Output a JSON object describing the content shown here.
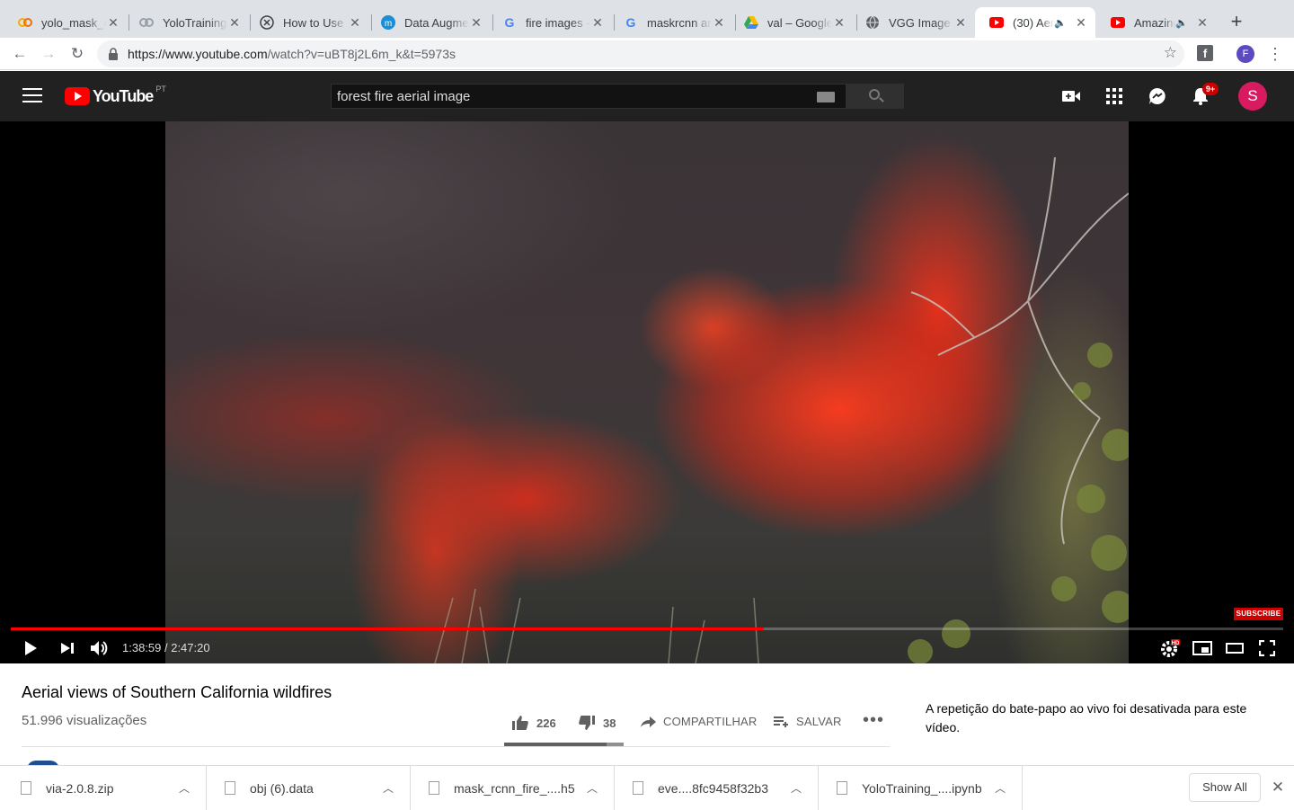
{
  "browser": {
    "tabs": [
      {
        "title": "yolo_mask_c",
        "icon": "colab-icon"
      },
      {
        "title": "YoloTraining",
        "icon": "colab-icon"
      },
      {
        "title": "How to Use",
        "icon": "x-circle-icon"
      },
      {
        "title": "Data Augme",
        "icon": "medium-icon"
      },
      {
        "title": "fire images -",
        "icon": "google-icon"
      },
      {
        "title": "maskrcnn ar",
        "icon": "google-icon"
      },
      {
        "title": "val – Google",
        "icon": "google-drive-icon"
      },
      {
        "title": "VGG Image /",
        "icon": "globe-icon"
      },
      {
        "title": "(30) Aer",
        "icon": "youtube-icon"
      },
      {
        "title": "Amazing",
        "icon": "youtube-icon"
      }
    ],
    "url_host": "https://www.youtube.com",
    "url_path": "/watch?v=uBT8j2L6m_k&t=5973s",
    "profile_initial": "F"
  },
  "youtube": {
    "logo_text": "YouTube",
    "region": "PT",
    "search_query": "forest fire aerial image",
    "notification_count": "9+",
    "avatar_initial": "S"
  },
  "player": {
    "subscribe_label": "SUBSCRIBE",
    "current_time": "1:38:59",
    "duration": "2:47:20",
    "time_display": "1:38:59 / 2:47:20",
    "progress_fraction": 0.592,
    "hd_badge": "HD"
  },
  "video": {
    "title": "Aerial views of Southern California wildfires",
    "views": "51.996 visualizações",
    "likes": "226",
    "dislikes": "38",
    "share_label": "COMPARTILHAR",
    "save_label": "SALVAR",
    "like_fraction": 0.856
  },
  "chat": {
    "replay_disabled_message": "A repetição do bate-papo ao vivo foi desativada para este vídeo."
  },
  "downloads": {
    "items": [
      {
        "name": "via-2.0.8.zip"
      },
      {
        "name": "obj (6).data"
      },
      {
        "name": "mask_rcnn_fire_....h5"
      },
      {
        "name": "eve....8fc9458f32b3"
      },
      {
        "name": "YoloTraining_....ipynb"
      }
    ],
    "show_all_label": "Show All"
  },
  "colors": {
    "youtube_red": "#ff0000",
    "header_bg": "#212121",
    "tabstrip_bg": "#dee1e6"
  }
}
